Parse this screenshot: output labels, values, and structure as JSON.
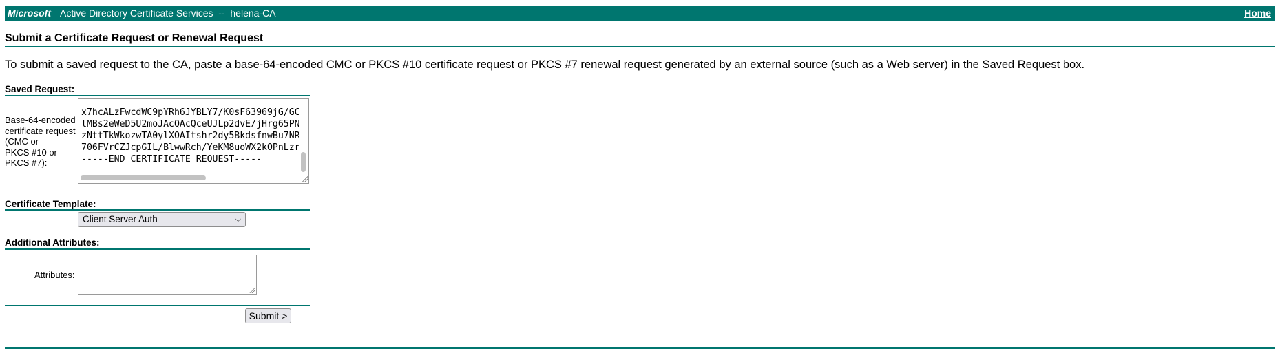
{
  "header": {
    "brand": "Microsoft",
    "service": "Active Directory Certificate Services  --  helena-CA",
    "home_link": "Home"
  },
  "page": {
    "title": "Submit a Certificate Request or Renewal Request",
    "instructions": "To submit a saved request to the CA, paste a base-64-encoded CMC or PKCS #10 certificate request or PKCS #7 renewal request generated by an external source (such as a Web server) in the Saved Request box."
  },
  "saved_request": {
    "section_label": "Saved Request:",
    "field_label": [
      "Base-64-encoded",
      "certificate request",
      "(CMC or",
      "PKCS #10 or",
      "PKCS #7):"
    ],
    "lines": [
      "x7hcALzFwcdWC9pYRh6JYBLY7/K0sF63969jG/GC",
      "lMBs2eWeD5U2moJAcQAcQceUJLp2dvE/jHrg65PN",
      "zNttTkWkozwTA0ylXOAItshr2dy5BkdsfnwBu7NR",
      "706FVrCZJcpGIL/BlwwRch/YeKM8uoWX2kOPnLzr",
      "-----END CERTIFICATE REQUEST-----"
    ]
  },
  "certificate_template": {
    "section_label": "Certificate Template:",
    "selected": "Client Server Auth"
  },
  "additional_attributes": {
    "section_label": "Additional Attributes:",
    "field_label": "Attributes:",
    "value": ""
  },
  "actions": {
    "submit_label": "Submit >"
  },
  "colors": {
    "accent": "#00766f"
  }
}
